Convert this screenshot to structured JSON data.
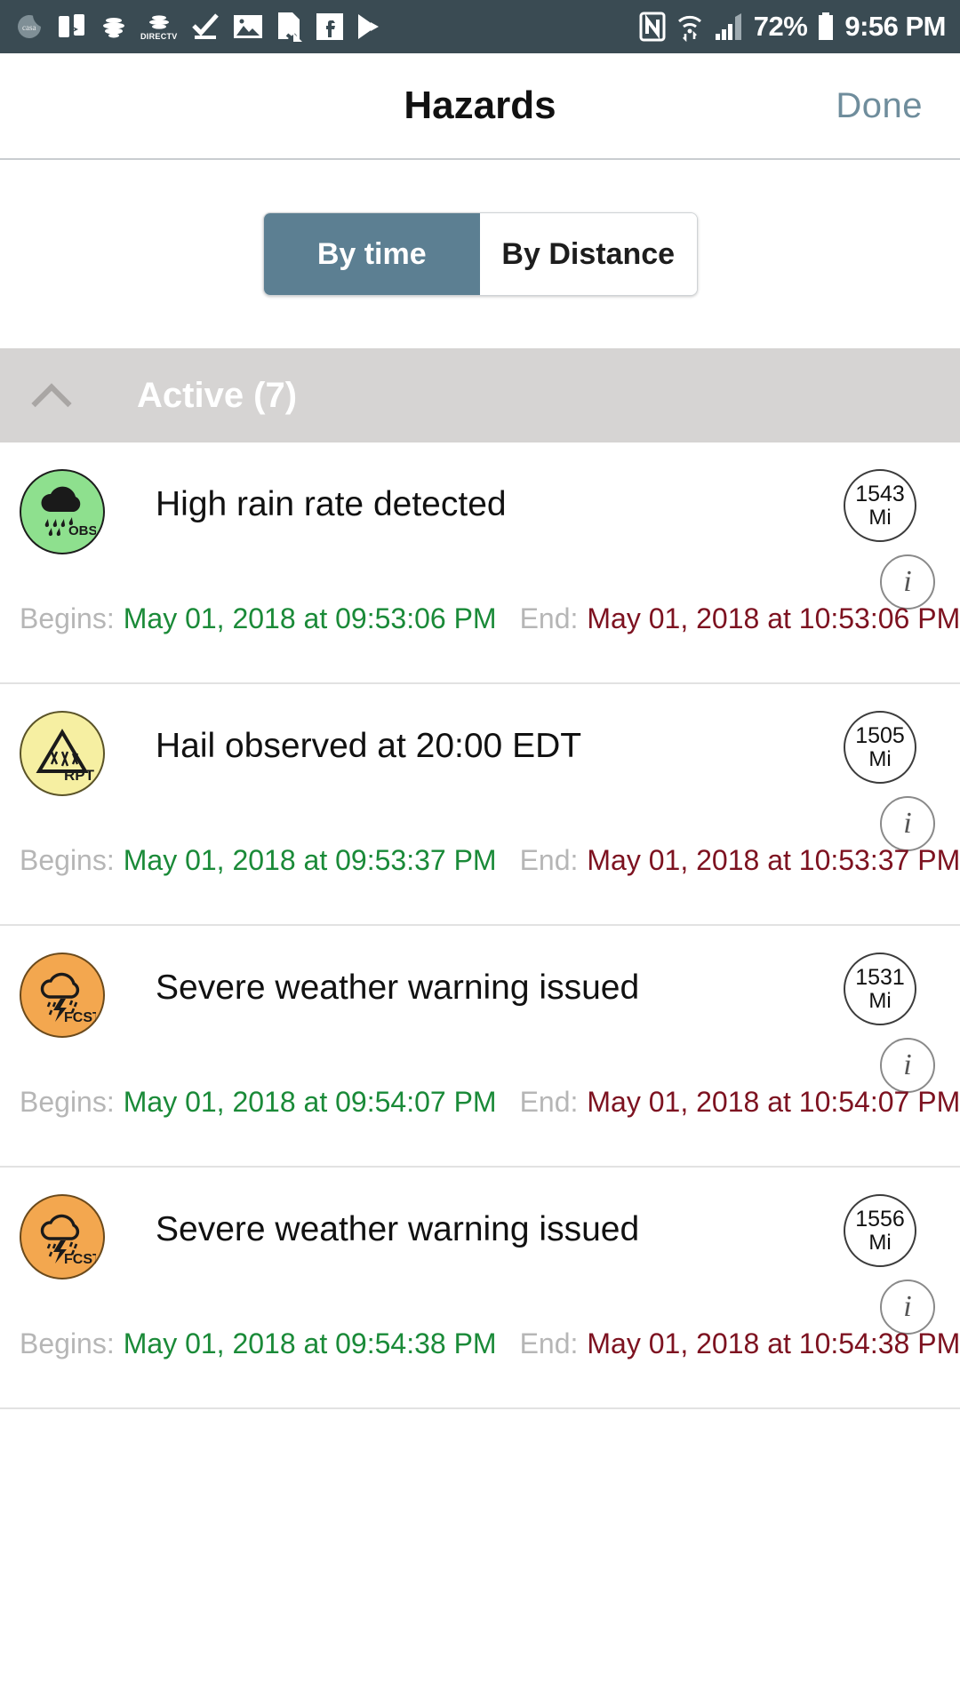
{
  "statusbar": {
    "left_icons": [
      "casa-logo-icon",
      "device-transfer-icon",
      "att-icon",
      "directv-icon",
      "checkmark-download-icon",
      "gallery-image-icon",
      "document-error-icon",
      "facebook-icon",
      "play-store-icon"
    ],
    "directv_label": "DIRECTV",
    "right_icons": [
      "nfc-icon",
      "wifi-transfer-icon",
      "cell-signal-icon",
      "battery-icon"
    ],
    "battery_percent": "72%",
    "clock": "9:56 PM"
  },
  "header": {
    "title": "Hazards",
    "done_label": "Done"
  },
  "segmented": {
    "options": [
      {
        "label": "By time",
        "selected": true
      },
      {
        "label": "By Distance",
        "selected": false
      }
    ],
    "selected_color": "#5c7f92"
  },
  "section": {
    "title": "Active (7)",
    "collapse_icon": "chevron-up-icon",
    "background": "#d6d4d3"
  },
  "labels": {
    "begins": "Begins:",
    "end": "End:",
    "distance_unit": "Mi",
    "info_glyph": "i"
  },
  "hazards": [
    {
      "icon": {
        "name": "rain-observed-icon",
        "tag": "OBS",
        "color": "#8ee08e",
        "kind": "green"
      },
      "title": "High rain rate detected",
      "distance": "1543",
      "unit": "Mi",
      "begins": "May 01, 2018 at 09:53:06 PM",
      "end": "May 01, 2018 at 10:53:06 PM"
    },
    {
      "icon": {
        "name": "hail-report-icon",
        "tag": "RPT",
        "color": "#f6efa2",
        "kind": "yellow"
      },
      "title": "Hail observed at 20:00 EDT",
      "distance": "1505",
      "unit": "Mi",
      "begins": "May 01, 2018 at 09:53:37 PM",
      "end": "May 01, 2018 at 10:53:37 PM"
    },
    {
      "icon": {
        "name": "severe-forecast-icon",
        "tag": "FCST",
        "color": "#f3a74f",
        "kind": "orange"
      },
      "title": "Severe weather warning issued",
      "distance": "1531",
      "unit": "Mi",
      "begins": "May 01, 2018 at 09:54:07 PM",
      "end": "May 01, 2018 at 10:54:07 PM"
    },
    {
      "icon": {
        "name": "severe-forecast-icon",
        "tag": "FCST",
        "color": "#f3a74f",
        "kind": "orange"
      },
      "title": "Severe weather warning issued",
      "distance": "1556",
      "unit": "Mi",
      "begins": "May 01, 2018 at 09:54:38 PM",
      "end": "May 01, 2018 at 10:54:38 PM"
    }
  ]
}
